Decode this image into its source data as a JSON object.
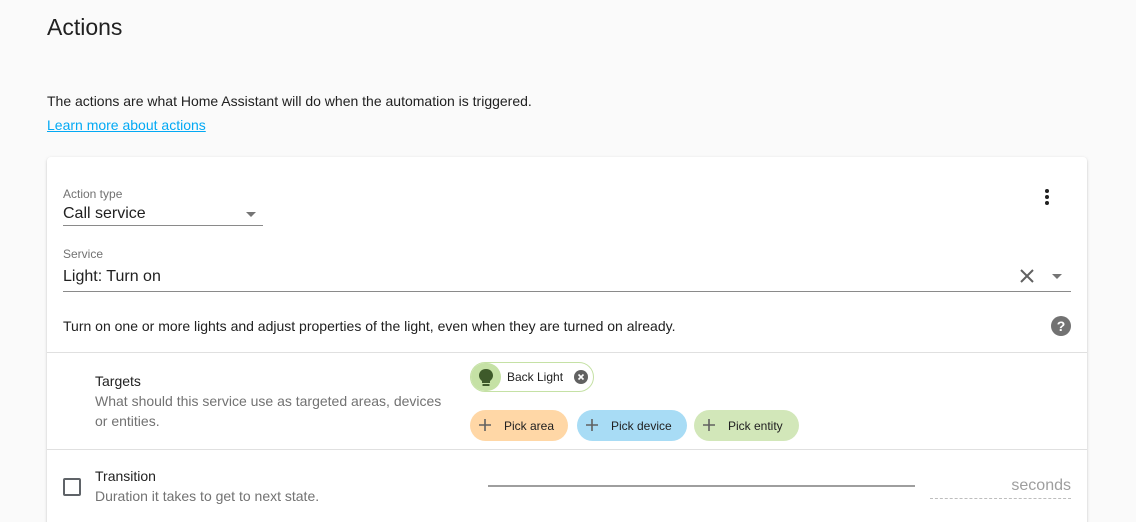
{
  "section": {
    "title": "Actions",
    "intro": "The actions are what Home Assistant will do when the automation is triggered.",
    "learn_more": "Learn more about actions"
  },
  "action": {
    "type_label": "Action type",
    "type_value": "Call service",
    "service_label": "Service",
    "service_value": "Light: Turn on",
    "description": "Turn on one or more lights and adjust properties of the light, even when they are turned on already."
  },
  "targets": {
    "title": "Targets",
    "description": "What should this service use as targeted areas, devices or entities.",
    "selected_entity": {
      "label": "Back Light",
      "icon": "lightbulb-icon"
    },
    "pickers": [
      {
        "label": "Pick area",
        "color": "#ffd7a6"
      },
      {
        "label": "Pick device",
        "color": "#a8dcf5"
      },
      {
        "label": "Pick entity",
        "color": "#d2e7b9"
      }
    ]
  },
  "transition": {
    "title": "Transition",
    "description": "Duration it takes to get to next state.",
    "unit": "seconds",
    "enabled": false
  },
  "colors": {
    "link": "#03a9f4",
    "entity_chip": "#c5e1a5",
    "help_icon": "#727272"
  },
  "icons": [
    "more-vert-icon",
    "close-icon",
    "chevron-down-icon",
    "help-icon",
    "lightbulb-icon",
    "remove-icon",
    "plus-icon"
  ]
}
